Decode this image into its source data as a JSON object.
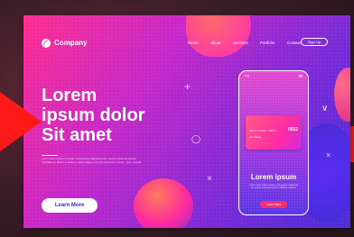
{
  "nav": {
    "brand": "Company",
    "links": [
      "Home",
      "About",
      "Services",
      "Portfolio",
      "Contact"
    ],
    "signup": "Sign Up"
  },
  "hero": {
    "title_lines": [
      "Lorem",
      "ipsum dolor",
      "Sit amet"
    ],
    "text": "Lorem ipsum dolor sit amet, consectetur adipiscing elit, sed do eiusmod tempor incididunt ut labore et dolore magna aliqua. Ut enim ad minim veniam, quis nostrud.",
    "button": "Learn More"
  },
  "phone": {
    "status_time": "9:41",
    "status_icons": "▮▮▮",
    "card_number": "0000  0000  0000",
    "card_big": "0652",
    "card_name": "Your Name",
    "title": "Lorem ipsum",
    "text": "Lorem ipsum dolor sit amet, consectetur adipiscing elit, sed do eiusmod tempor incididunt ut labore.",
    "button": "Learn More"
  },
  "colors": {
    "accent": "#ff2d8f",
    "secondary": "#7a2ad8",
    "button_text": "#3b2cc9",
    "phone_button": "#ff2d6f"
  },
  "icons": {
    "plus": "+",
    "chevron": "∨",
    "close": "×",
    "ring": "◯"
  }
}
